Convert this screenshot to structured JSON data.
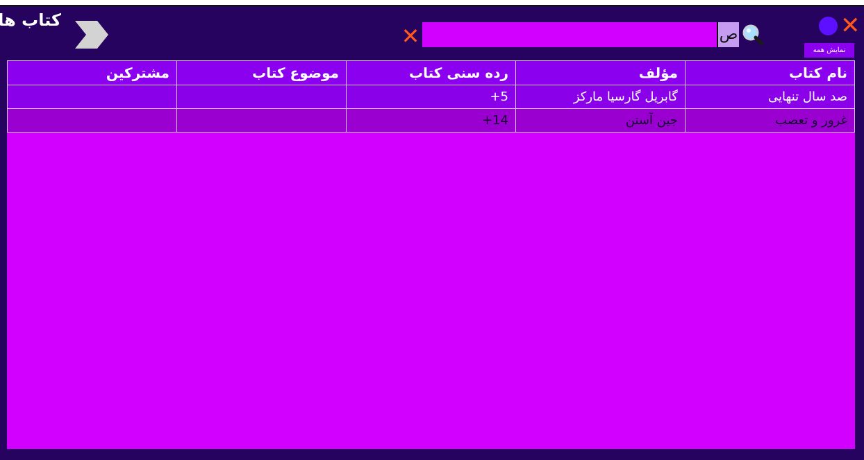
{
  "window": {
    "title": "کتاب ها",
    "show_all_label": "نمایش همه"
  },
  "search": {
    "value": "ص",
    "icon": "search-icon"
  },
  "icons": {
    "close": "close-icon",
    "clear_search": "clear-icon",
    "back": "chevron-right-icon",
    "indicator": "circle-icon"
  },
  "table": {
    "headers": [
      "نام کتاب",
      "مؤلف",
      "رده سنی کتاب",
      "موضوع کتاب",
      "مشترکین"
    ],
    "rows": [
      [
        "صد سال تنهایی",
        "گابریل گارسیا مارکز",
        "+5",
        "",
        ""
      ],
      [
        "غرور و تعصب",
        "جین آستن",
        "+14",
        "",
        ""
      ]
    ]
  },
  "colors": {
    "window_bg": "#26035e",
    "grid_bg": "#d100ff",
    "header_bg": "#8b00ee",
    "close": "#ff5a1e",
    "indicator": "#5d10ff"
  }
}
